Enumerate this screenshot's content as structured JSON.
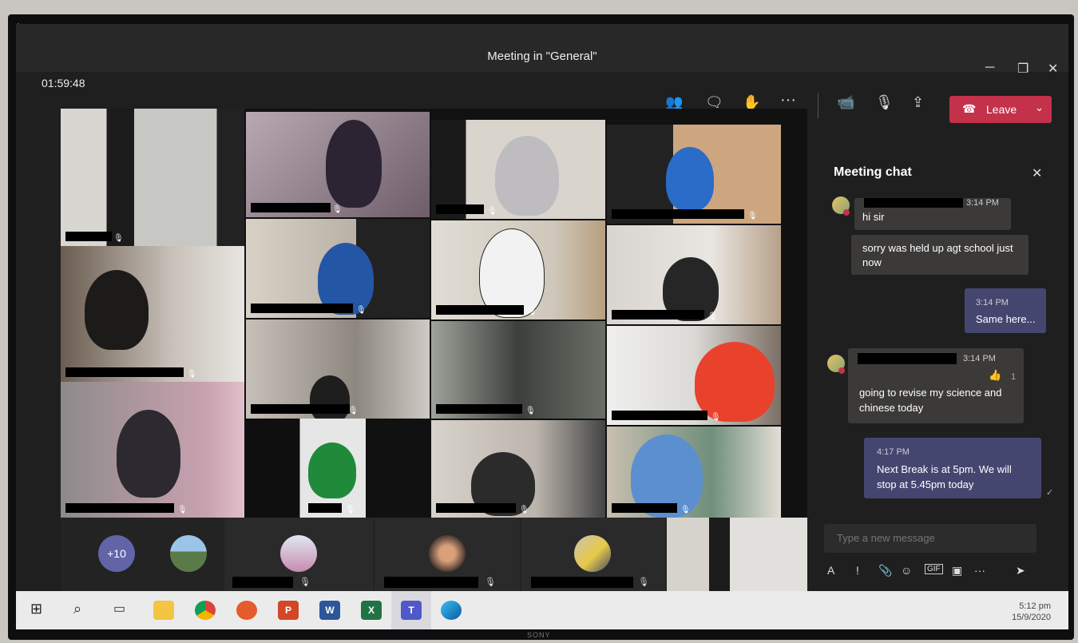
{
  "window": {
    "title": "Meeting in \"General\"",
    "minimize": "─",
    "maximize": "❐",
    "close": "✕"
  },
  "meeting": {
    "timer": "01:59:48",
    "leave_label": "Leave",
    "overflow_count": "+10"
  },
  "toolbar": {
    "icons": [
      "participants-icon",
      "chat-icon",
      "raise-hand-icon",
      "more-icon",
      "camera-icon",
      "mic-off-icon",
      "share-screen-icon"
    ]
  },
  "chat": {
    "title": "Meeting chat",
    "messages": [
      {
        "time": "3:14 PM",
        "text": "hi sir"
      },
      {
        "text": "sorry was held up agt school just now"
      },
      {
        "time": "3:14 PM",
        "text": "Same here...",
        "mine": true
      },
      {
        "time": "3:14 PM",
        "text": "going to revise my science and chinese today",
        "reaction": "👍",
        "reaction_count": "1"
      },
      {
        "time": "4:17 PM",
        "text": "Next Break is at 5pm. We will stop at 5.45pm today",
        "mine": true
      }
    ],
    "compose_placeholder": "Type a new message"
  },
  "taskbar": {
    "time": "5:12 pm",
    "date": "15/9/2020"
  },
  "brand": "SONY",
  "colors": {
    "leave": "#c4314b",
    "my_bubble": "#454670",
    "other_bubble": "#3b3a39",
    "accent": "#6264a7"
  }
}
